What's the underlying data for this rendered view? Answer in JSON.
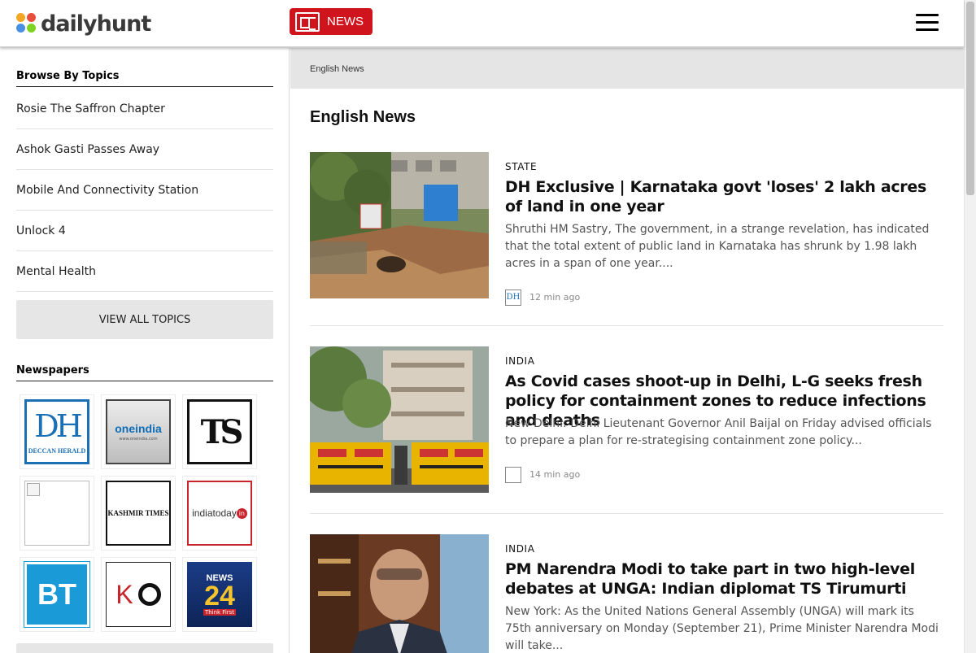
{
  "header": {
    "logo_text": "dailyhunt",
    "news_label": "NEWS"
  },
  "sidebar": {
    "topics_title": "Browse By Topics",
    "topics": [
      "Rosie The Saffron Chapter",
      "Ashok Gasti Passes Away",
      "Mobile And Connectivity Station",
      "Unlock 4",
      "Mental Health"
    ],
    "view_all_label": "VIEW ALL TOPICS",
    "newspapers_title": "Newspapers",
    "newspapers": {
      "dh_big": "DH",
      "dh_small": "DECCAN HERALD",
      "oneindia_big": "oneindia",
      "oneindia_small": "www.oneindia.com",
      "ts_big": "TS",
      "kt_big": "KASHMIR TIMES",
      "itoday_big": "indiatoday",
      "itoday_in": "in",
      "bt_big": "BT",
      "ko_k": "K",
      "n24_top": "NEWS",
      "n24_big": "24",
      "n24_small": "Think First"
    }
  },
  "main": {
    "breadcrumb": "English News",
    "title": "English News",
    "articles": [
      {
        "category": "STATE",
        "headline": "DH Exclusive | Karnataka govt 'loses' 2 lakh acres of land in one year",
        "summary": "Shruthi HM Sastry, The government, in a strange revelation, has indicated that the total extent of public land in Karnataka has shrunk by 1.98 lakh acres in a span of one year....",
        "source_icon": "DH",
        "time": "12 min ago"
      },
      {
        "category": "INDIA",
        "headline": "As Covid cases shoot-up in Delhi, L-G seeks fresh policy for containment zones to reduce infections and deaths",
        "summary": "New Delhi: Delhi Lieutenant Governor Anil Baijal on Friday advised officials to prepare a plan for re-strategising containment zone policy...",
        "source_icon": "",
        "time": "14 min ago"
      },
      {
        "category": "INDIA",
        "headline": "PM Narendra Modi to take part in two high-level debates at UNGA: Indian diplomat TS Tirumurti",
        "summary": "New York: As the United Nations General Assembly (UNGA) will mark its 75th anniversary on Monday (September 21), Prime Minister Narendra Modi will take...",
        "source_icon": "",
        "time": ""
      }
    ]
  },
  "colors": {
    "brand_red": "#d0141e",
    "breadcrumb_bg": "#e5e5e5",
    "button_bg": "#e6e6e6"
  }
}
